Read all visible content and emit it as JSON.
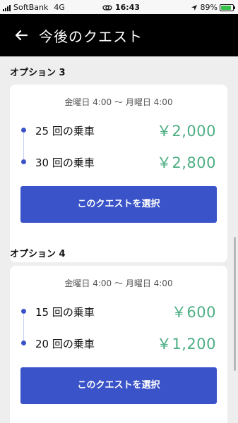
{
  "status_bar": {
    "carrier": "SoftBank",
    "network": "4G",
    "time": "16:43",
    "battery": "89%",
    "battery_level": 0.89,
    "battery_color": "#38c24a"
  },
  "header": {
    "title": "今後のクエスト",
    "back_icon": "arrow-left-icon"
  },
  "options": [
    {
      "label": "オプション 3",
      "range": "金曜日 4:00 〜 月曜日 4:00",
      "tiers": [
        {
          "rides": "25 回の乗車",
          "reward": "￥2,000"
        },
        {
          "rides": "30 回の乗車",
          "reward": "￥2,800"
        }
      ],
      "button": "このクエストを選択"
    },
    {
      "label": "オプション 4",
      "range": "金曜日 4:00 〜 月曜日 4:00",
      "tiers": [
        {
          "rides": "15 回の乗車",
          "reward": "￥600"
        },
        {
          "rides": "20 回の乗車",
          "reward": "￥1,200"
        }
      ],
      "button": "このクエストを選択"
    }
  ],
  "colors": {
    "accent": "#3a53c8",
    "reward": "#4cae83",
    "header_bg": "#000000",
    "page_bg": "#eeeeee"
  }
}
